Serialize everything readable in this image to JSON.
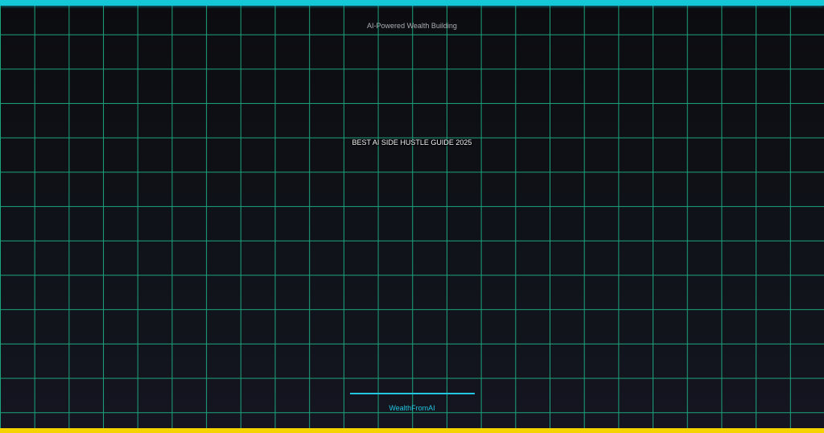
{
  "banner": {
    "tagline": "AI-Powered Wealth Building",
    "title": "BEST AI SIDE HUSTLE GUIDE 2025",
    "brand": "WealthFromAI"
  },
  "colors": {
    "background": "#0e0e12",
    "grid": "#1fbf8f",
    "top_bar": "#14c8d8",
    "bottom_bar": "#f5d300",
    "accent": "#22c6e0"
  }
}
